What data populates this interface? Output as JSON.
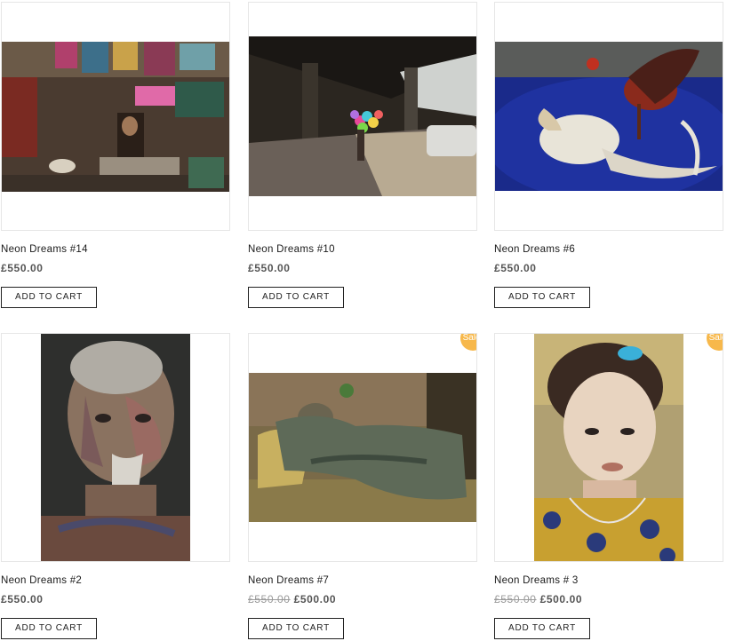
{
  "products": [
    {
      "title": "Neon Dreams #14",
      "price": "£550.00",
      "button": "ADD TO CART"
    },
    {
      "title": "Neon Dreams #10",
      "price": "£550.00",
      "button": "ADD TO CART"
    },
    {
      "title": "Neon Dreams #6",
      "price": "£550.00",
      "button": "ADD TO CART"
    },
    {
      "title": "Neon Dreams #2",
      "price": "£550.00",
      "button": "ADD TO CART"
    },
    {
      "title": "Neon Dreams #7",
      "old_price": "£550.00",
      "price": "£500.00",
      "sale": "Sale!",
      "button": "ADD TO CART"
    },
    {
      "title": "Neon Dreams # 3",
      "old_price": "£550.00",
      "price": "£500.00",
      "sale": "Sale!",
      "button": "ADD TO CART"
    }
  ],
  "colors": {
    "sale_badge": "#f7b84b",
    "border": "#e6e6e6",
    "price": "#555555"
  }
}
